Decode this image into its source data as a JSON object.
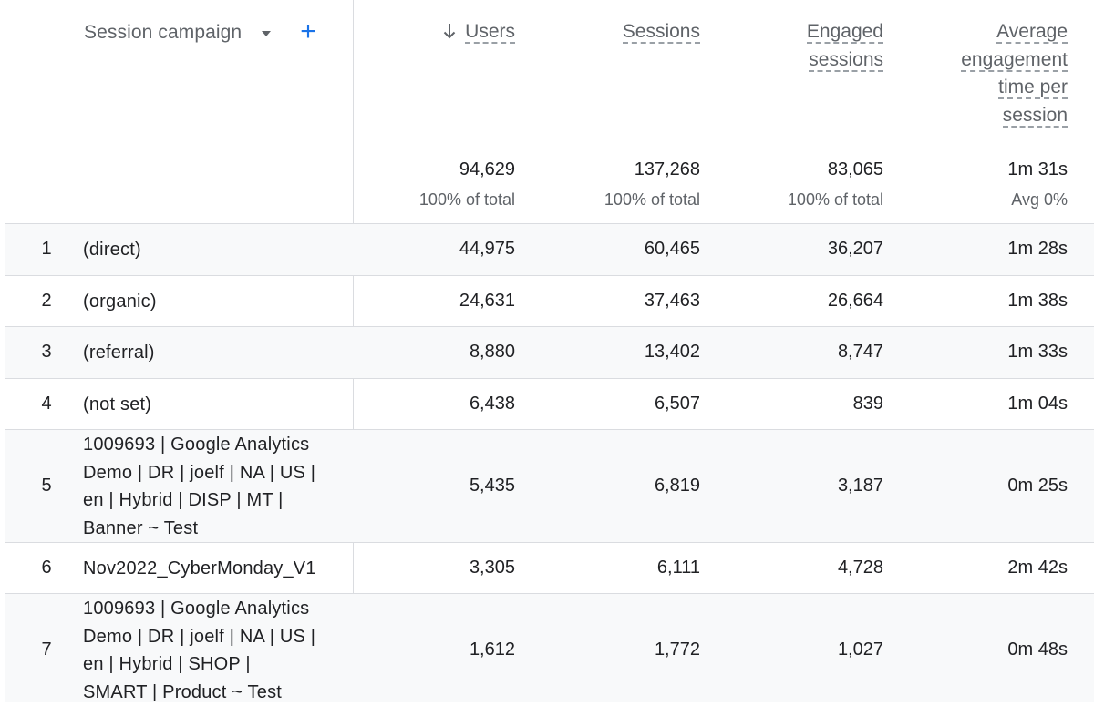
{
  "dimension": {
    "label": "Session campaign"
  },
  "columns": [
    {
      "lines": [
        "Users"
      ],
      "sorted": true
    },
    {
      "lines": [
        "Sessions"
      ]
    },
    {
      "lines": [
        "Engaged",
        "sessions"
      ]
    },
    {
      "lines": [
        "Average",
        "engagement",
        "time per",
        "session"
      ]
    }
  ],
  "totals": [
    {
      "value": "94,629",
      "note": "100% of total"
    },
    {
      "value": "137,268",
      "note": "100% of total"
    },
    {
      "value": "83,065",
      "note": "100% of total"
    },
    {
      "value": "1m 31s",
      "note": "Avg 0%"
    }
  ],
  "rows": [
    {
      "index": "1",
      "name": [
        "(direct)"
      ],
      "values": [
        "44,975",
        "60,465",
        "36,207",
        "1m 28s"
      ]
    },
    {
      "index": "2",
      "name": [
        "(organic)"
      ],
      "values": [
        "24,631",
        "37,463",
        "26,664",
        "1m 38s"
      ]
    },
    {
      "index": "3",
      "name": [
        "(referral)"
      ],
      "values": [
        "8,880",
        "13,402",
        "8,747",
        "1m 33s"
      ]
    },
    {
      "index": "4",
      "name": [
        "(not set)"
      ],
      "values": [
        "6,438",
        "6,507",
        "839",
        "1m 04s"
      ]
    },
    {
      "index": "5",
      "name": [
        "1009693 | Google Analytics",
        "Demo | DR | joelf | NA | US |",
        "en | Hybrid | DISP | MT |",
        "Banner ~ Test"
      ],
      "values": [
        "5,435",
        "6,819",
        "3,187",
        "0m 25s"
      ]
    },
    {
      "index": "6",
      "name": [
        "Nov2022_CyberMonday_V1"
      ],
      "values": [
        "3,305",
        "6,111",
        "4,728",
        "2m 42s"
      ]
    },
    {
      "index": "7",
      "name": [
        "1009693 | Google Analytics",
        "Demo | DR | joelf | NA | US |",
        "en | Hybrid | SHOP |",
        "SMART | Product ~ Test"
      ],
      "values": [
        "1,612",
        "1,772",
        "1,027",
        "0m 48s"
      ]
    }
  ]
}
